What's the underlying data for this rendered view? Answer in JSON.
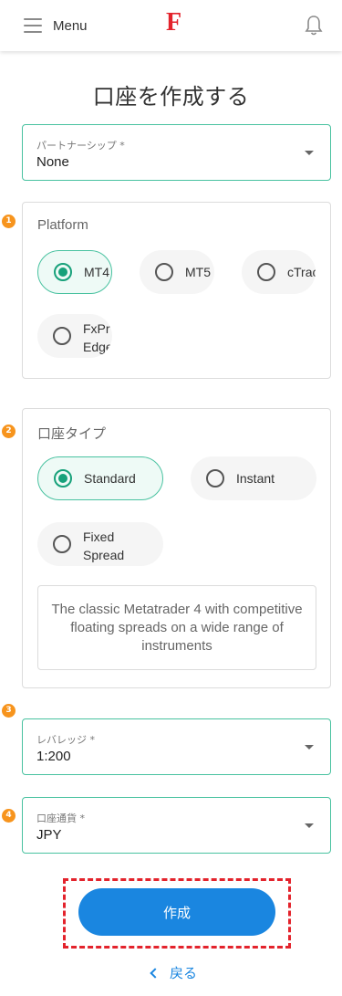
{
  "header": {
    "menu_label": "Menu",
    "logo_text": "F",
    "brand_color": "#e3232c"
  },
  "page": {
    "title": "口座を作成する"
  },
  "partnership": {
    "label": "パートナーシップ *",
    "value": "None"
  },
  "steps": [
    "1",
    "2",
    "3",
    "4"
  ],
  "platform": {
    "title": "Platform",
    "options": [
      {
        "label": "MT4",
        "selected": true
      },
      {
        "label": "MT5",
        "selected": false
      },
      {
        "label": "cTrac",
        "selected": false
      },
      {
        "label_line1": "FxPr",
        "label_line2": "Edge",
        "selected": false
      }
    ]
  },
  "account_type": {
    "title": "口座タイプ",
    "options": [
      {
        "label": "Standard",
        "selected": true
      },
      {
        "label": "Instant",
        "selected": false
      },
      {
        "label_line1": "Fixed",
        "label_line2": "Spread",
        "selected": false
      }
    ],
    "description": "The classic Metatrader 4 with competitive floating spreads on a wide range of instruments"
  },
  "leverage": {
    "label": "レバレッジ *",
    "value": "1:200"
  },
  "currency": {
    "label": "口座通貨 *",
    "value": "JPY"
  },
  "actions": {
    "submit_label": "作成",
    "back_label": "戻る"
  },
  "colors": {
    "accent_green": "#49c2a0",
    "radio_green": "#17a17a",
    "button_blue": "#1a86e0",
    "step_orange": "#f7941d",
    "highlight_red": "#e3232c"
  }
}
